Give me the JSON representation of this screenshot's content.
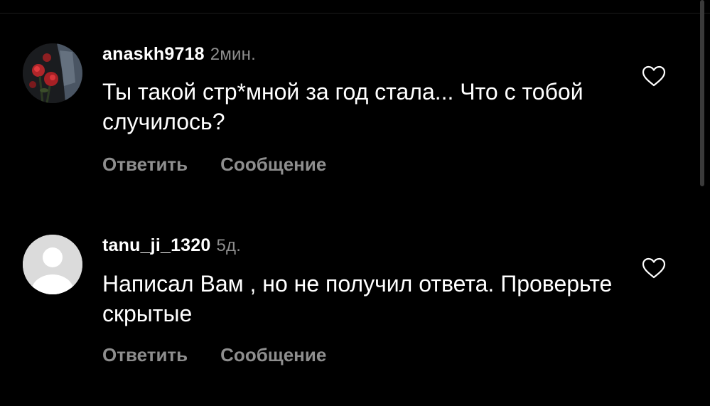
{
  "comments": [
    {
      "username": "anaskh9718",
      "time": "2мин.",
      "text": "Ты такой стр*мной за год стала... Что с тобой случилось?",
      "reply_label": "Ответить",
      "message_label": "Сообщение",
      "avatar": "photo-avatar",
      "like_icon": "heart-outline-icon"
    },
    {
      "username": "tanu_ji_1320",
      "time": "5д.",
      "text": "Написал Вам , но не получил ответа. Проверьте скрытые",
      "reply_label": "Ответить",
      "message_label": "Сообщение",
      "avatar": "default-avatar",
      "like_icon": "heart-outline-icon"
    }
  ],
  "colors": {
    "background": "#000000",
    "primary_text": "#ffffff",
    "secondary_text": "#8e8e8e"
  }
}
